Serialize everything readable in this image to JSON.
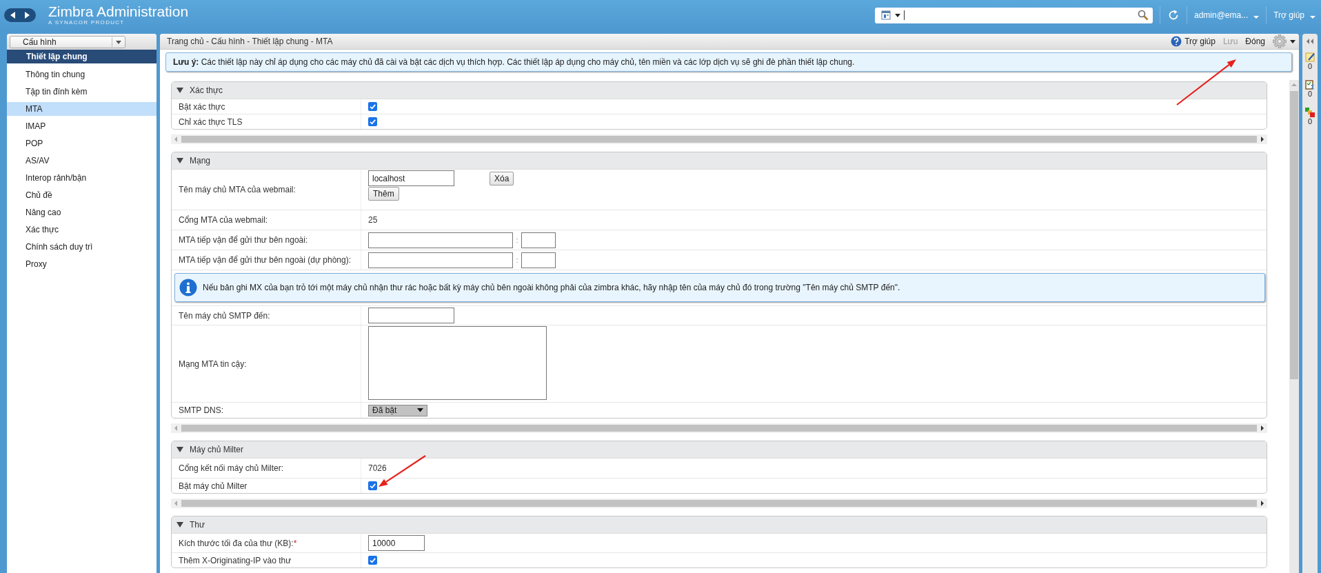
{
  "topbar": {
    "title": "Zimbra Administration",
    "subtitle": "A SYNACOR PRODUCT",
    "user": "admin@ema...",
    "help": "Trợ giúp"
  },
  "sidebar": {
    "dropdown": "Cấu hình",
    "heading": "Thiết lập chung",
    "items": [
      {
        "label": "Thông tin chung",
        "selected": false
      },
      {
        "label": "Tập tin đính kèm",
        "selected": false
      },
      {
        "label": "MTA",
        "selected": true
      },
      {
        "label": "IMAP",
        "selected": false
      },
      {
        "label": "POP",
        "selected": false
      },
      {
        "label": "AS/AV",
        "selected": false
      },
      {
        "label": "Interop rảnh/bận",
        "selected": false
      },
      {
        "label": "Chủ đề",
        "selected": false
      },
      {
        "label": "Nâng cao",
        "selected": false
      },
      {
        "label": "Xác thực",
        "selected": false
      },
      {
        "label": "Chính sách duy trì",
        "selected": false
      },
      {
        "label": "Proxy",
        "selected": false
      }
    ]
  },
  "breadcrumb": "Trang chủ - Cấu hình - Thiết lập chung - MTA",
  "toolbar": {
    "help": "Trợ giúp",
    "save": {
      "label": "Lưu",
      "disabled": true
    },
    "close": {
      "label": "Đóng",
      "disabled": false
    }
  },
  "note": "**Lưu ý:** Các thiết lập này chỉ áp dụng cho các máy chủ đã cài và bật các dịch vụ thích hợp. Các thiết lập áp dụng cho máy chủ, tên miền và các lớp dịch vụ sẽ ghi đè phần thiết lập chung.",
  "sections": [
    {
      "title": "Xác thực",
      "expanded": true,
      "rows": [
        {
          "kind": "checkbox",
          "label": "Bật xác thực",
          "checked": true
        },
        {
          "kind": "checkbox",
          "label": "Chỉ xác thực TLS",
          "checked": true
        }
      ]
    },
    {
      "title": "Mạng",
      "expanded": true,
      "rows": [
        {
          "kind": "list_field",
          "label": "Tên máy chủ MTA của webmail:",
          "value": "localhost",
          "remove_button": "Xóa",
          "add_button": "Thêm"
        },
        {
          "kind": "text",
          "label": "Cổng MTA của webmail:",
          "value": "25"
        },
        {
          "kind": "host_port",
          "label": "MTA tiếp vận để gửi thư bên ngoài:",
          "separator": ":"
        },
        {
          "kind": "host_port",
          "label": "MTA tiếp vận để gửi thư bên ngoài (dự phòng):",
          "separator": ":"
        },
        {
          "kind": "info",
          "text": "Nếu bản ghi MX của bạn trỏ tới một máy chủ nhận thư rác hoặc bất kỳ máy chủ bên ngoài không phải của zimbra khác, hãy nhập tên của máy chủ đó trong trường \"Tên máy chủ SMTP đến\"."
        },
        {
          "kind": "input",
          "label": "Tên máy chủ SMTP đến:"
        },
        {
          "kind": "textarea",
          "label": "Mạng MTA tin cậy:"
        },
        {
          "kind": "select",
          "label": "SMTP DNS:",
          "value": "Đã bật"
        }
      ]
    },
    {
      "title": "Máy chủ Milter",
      "expanded": true,
      "rows": [
        {
          "kind": "text",
          "label": "Cổng kết nối máy chủ Milter:",
          "value": "7026"
        },
        {
          "kind": "checkbox",
          "label": "Bật máy chủ Milter",
          "checked": true
        }
      ]
    },
    {
      "title": "Thư",
      "expanded": true,
      "rows": [
        {
          "kind": "input",
          "label": "Kích thước tối đa của thư (KB):",
          "required_mark": "*",
          "value": "10000"
        },
        {
          "kind": "checkbox",
          "label": "Thêm X-Originating-IP vào thư",
          "checked": true
        }
      ]
    }
  ],
  "right_strip": {
    "counts": [
      "0",
      "0",
      "0"
    ]
  }
}
